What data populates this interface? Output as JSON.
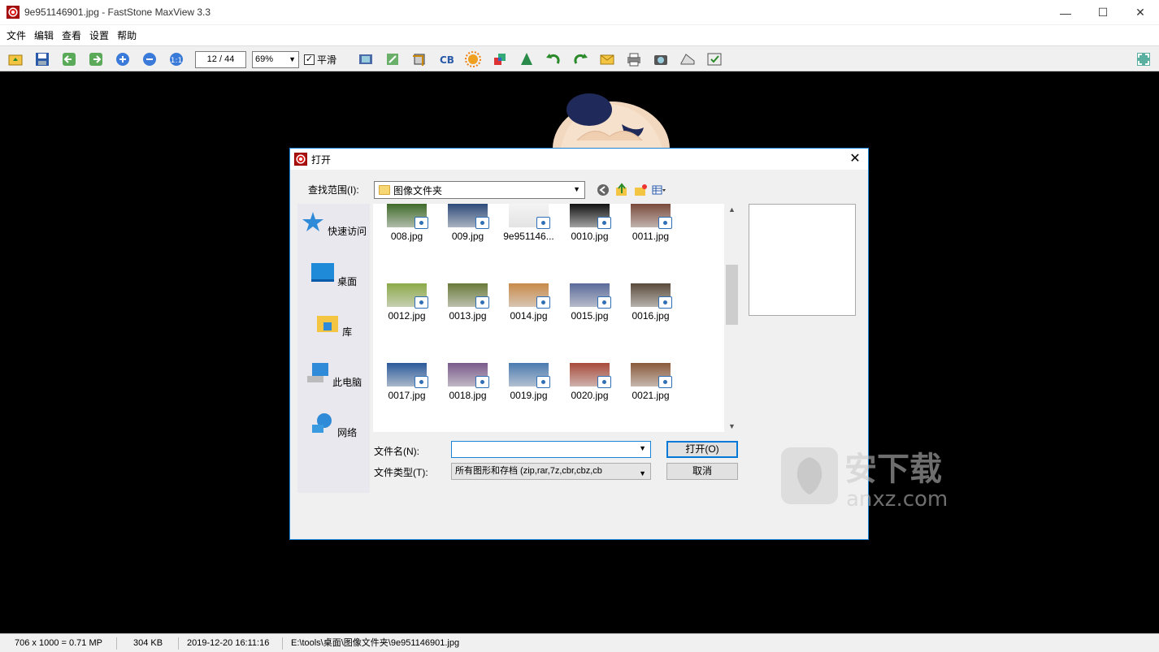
{
  "window": {
    "title": "9e951146901.jpg - FastStone MaxView 3.3",
    "controls": {
      "minimize": "—",
      "maximize": "☐",
      "close": "✕"
    }
  },
  "menu": [
    "文件",
    "编辑",
    "查看",
    "设置",
    "帮助"
  ],
  "toolbar": {
    "page_counter": "12 / 44",
    "zoom": "69%",
    "smooth_label": "平滑",
    "smooth_checked": "✓",
    "icons": [
      "open-folder-icon",
      "save-icon",
      "prev-image-icon",
      "next-image-icon",
      "zoom-in-icon",
      "zoom-out-icon",
      "actual-size-icon",
      "slideshow-icon",
      "resize-icon",
      "crop-icon",
      "text-cb-icon",
      "brightness-icon",
      "color-icon",
      "sharpen-icon",
      "rotate-left-icon",
      "rotate-right-icon",
      "email-icon",
      "print-icon",
      "screenshot-icon",
      "scanner-icon",
      "settings-check-icon",
      "fullscreen-icon"
    ]
  },
  "dialog": {
    "title": "打开",
    "close": "✕",
    "lookin_label": "查找范围(I):",
    "lookin_value": "图像文件夹",
    "places": [
      "快速访问",
      "桌面",
      "库",
      "此电脑",
      "网络"
    ],
    "files": [
      {
        "name": "008.jpg",
        "color": "#3f6b2a"
      },
      {
        "name": "009.jpg",
        "color": "#2c4a7a"
      },
      {
        "name": "9e951146...",
        "color": "#f4f4f4"
      },
      {
        "name": "0010.jpg",
        "color": "#111111"
      },
      {
        "name": "0011.jpg",
        "color": "#7a4a3a"
      },
      {
        "name": "0012.jpg",
        "color": "#8caa48"
      },
      {
        "name": "0013.jpg",
        "color": "#6a7a3a"
      },
      {
        "name": "0014.jpg",
        "color": "#c88a4a"
      },
      {
        "name": "0015.jpg",
        "color": "#5a6a9a"
      },
      {
        "name": "0016.jpg",
        "color": "#5a4a3a"
      },
      {
        "name": "0017.jpg",
        "color": "#2a5a9a"
      },
      {
        "name": "0018.jpg",
        "color": "#7a5a8a"
      },
      {
        "name": "0019.jpg",
        "color": "#4a7ab0"
      },
      {
        "name": "0020.jpg",
        "color": "#a84a3a"
      },
      {
        "name": "0021.jpg",
        "color": "#8a5a3a"
      }
    ],
    "filename_label": "文件名(N):",
    "filename_value": "",
    "filetype_label": "文件类型(T):",
    "filetype_value": "所有图形和存档 (zip,rar,7z,cbr,cbz,cb",
    "open_button": "打开(O)",
    "cancel_button": "取消"
  },
  "watermark": {
    "big": "安下载",
    "small": "anxz.com"
  },
  "status": {
    "dimensions": "706 x 1000 = 0.71 MP",
    "size": "304 KB",
    "date": "2019-12-20 16:11:16",
    "path": "E:\\tools\\桌面\\图像文件夹\\9e951146901.jpg"
  }
}
